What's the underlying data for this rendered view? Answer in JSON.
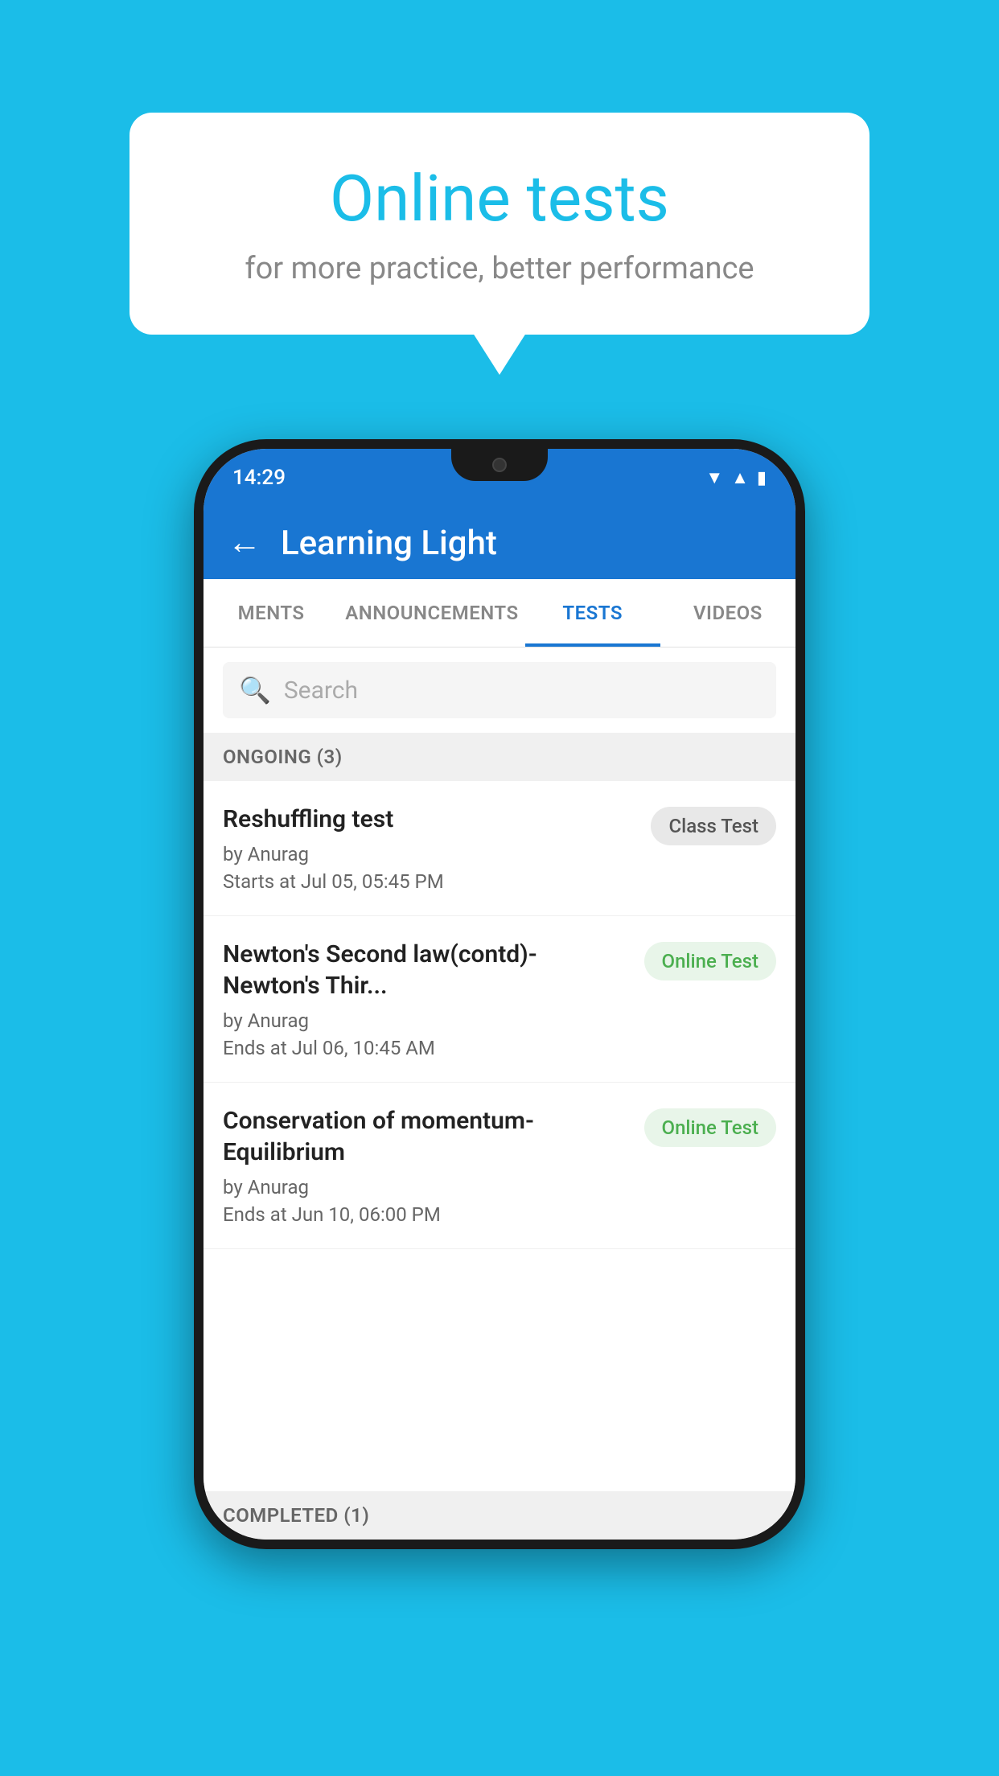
{
  "background": {
    "color": "#1BBDE8"
  },
  "bubble": {
    "title": "Online tests",
    "subtitle": "for more practice, better performance"
  },
  "phone": {
    "status": {
      "time": "14:29"
    },
    "header": {
      "title": "Learning Light",
      "back_label": "←"
    },
    "tabs": [
      {
        "label": "MENTS",
        "active": false
      },
      {
        "label": "ANNOUNCEMENTS",
        "active": false
      },
      {
        "label": "TESTS",
        "active": true
      },
      {
        "label": "VIDEOS",
        "active": false
      }
    ],
    "search": {
      "placeholder": "Search"
    },
    "ongoing_section": {
      "label": "ONGOING (3)"
    },
    "tests": [
      {
        "name": "Reshuffling test",
        "by": "by Anurag",
        "time": "Starts at  Jul 05, 05:45 PM",
        "badge": "Class Test",
        "badge_type": "class"
      },
      {
        "name": "Newton's Second law(contd)-Newton's Thir...",
        "by": "by Anurag",
        "time": "Ends at  Jul 06, 10:45 AM",
        "badge": "Online Test",
        "badge_type": "online"
      },
      {
        "name": "Conservation of momentum-Equilibrium",
        "by": "by Anurag",
        "time": "Ends at  Jun 10, 06:00 PM",
        "badge": "Online Test",
        "badge_type": "online"
      }
    ],
    "completed_section": {
      "label": "COMPLETED (1)"
    }
  }
}
